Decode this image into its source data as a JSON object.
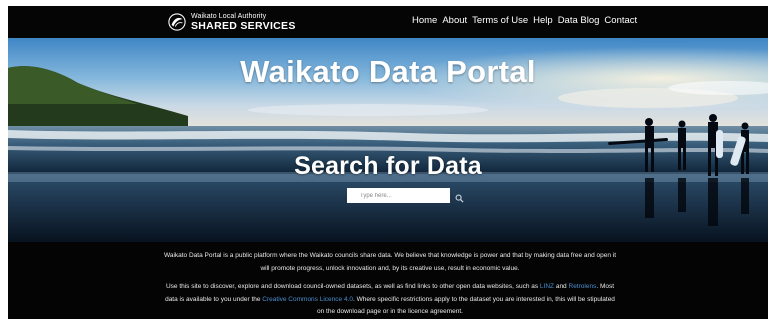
{
  "header": {
    "logo_small": "Waikato Local Authority",
    "logo_big": "SHARED SERVICES",
    "nav": [
      "Home",
      "About",
      "Terms of Use",
      "Help",
      "Data Blog",
      "Contact"
    ]
  },
  "hero": {
    "title": "Waikato Data Portal",
    "subtitle": "Search for Data",
    "search_placeholder": "Type here..."
  },
  "description": {
    "para1": "Waikato Data Portal is a public platform where the Waikato councils share data. We believe that knowledge is power and that by making data free and open it will promote progress, unlock innovation and, by its creative use, result in economic value.",
    "para2_a": "Use this site to discover, explore and download council-owned datasets, as well as find links to other open data websites, such as",
    "link_linz": "LINZ",
    "para2_b": "and",
    "link_retrolens": "Retrolens",
    "para2_c": ". Most data is available to you under the",
    "link_licence": "Creative Commons Licence 4.0",
    "para2_d": ". Where specific restrictions apply to the dataset you are interested in, this will be stipulated on the download page or in the licence agreement."
  },
  "colors": {
    "link": "#4a8fd0",
    "header_bg": "#050505",
    "text": "#ffffff"
  }
}
